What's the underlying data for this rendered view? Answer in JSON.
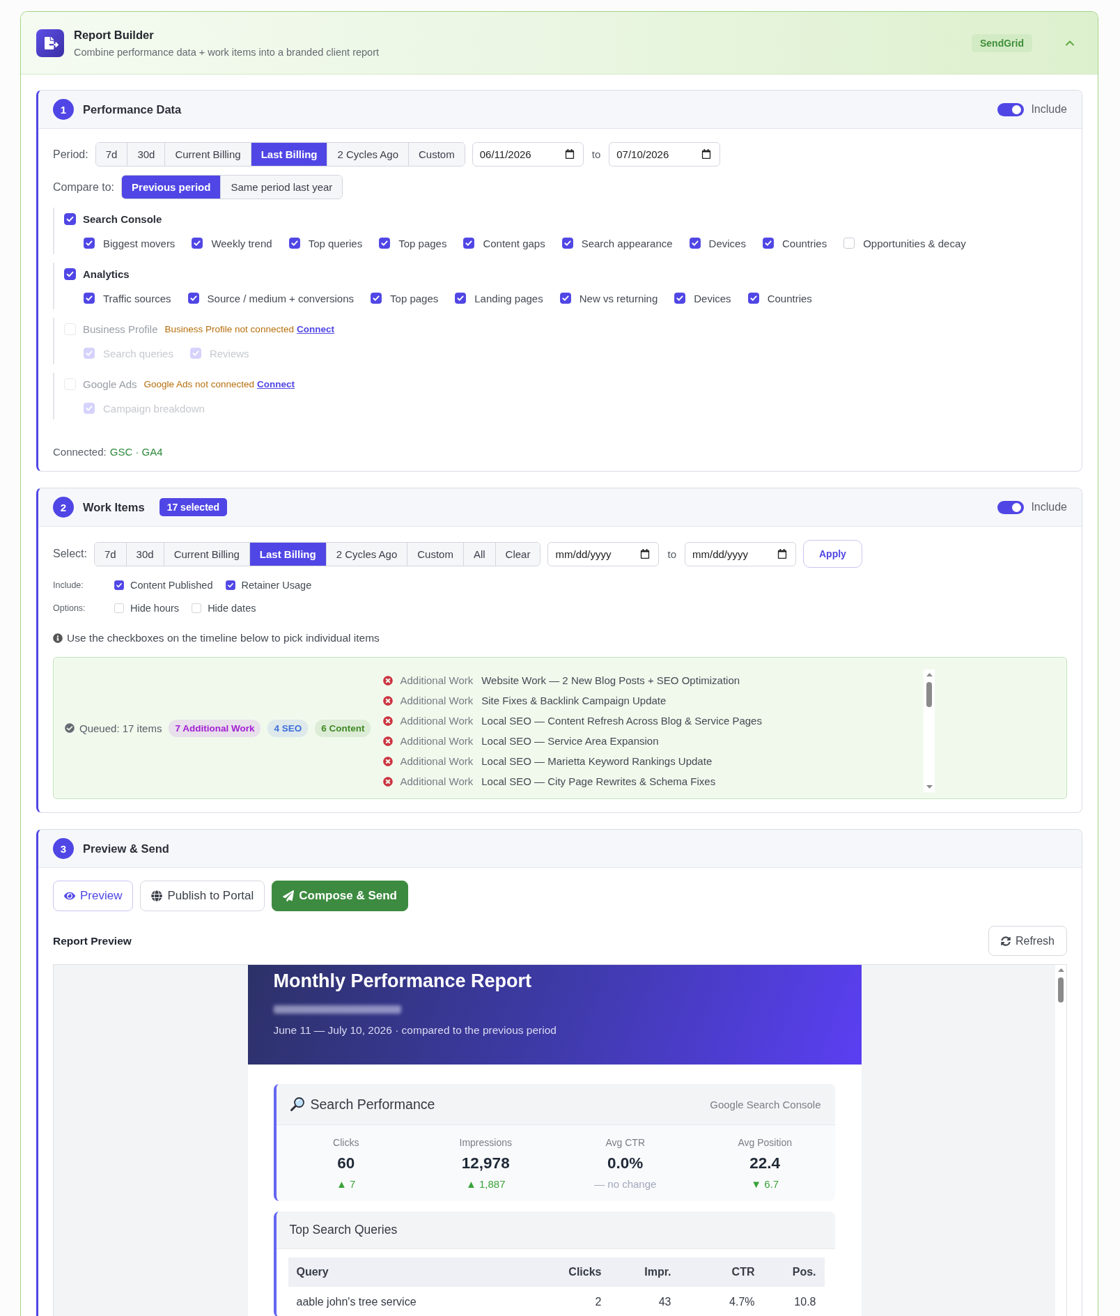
{
  "header": {
    "title": "Report Builder",
    "subtitle": "Combine performance data + work items into a branded client report",
    "badge": "SendGrid",
    "expanded": true
  },
  "performance_data": {
    "step": "1",
    "title": "Performance Data",
    "include": {
      "label": "Include",
      "on": true
    },
    "period": {
      "label": "Period:",
      "options": [
        {
          "label": "7d",
          "selected": false
        },
        {
          "label": "30d",
          "selected": false
        },
        {
          "label": "Current Billing",
          "selected": false
        },
        {
          "label": "Last Billing",
          "selected": true
        },
        {
          "label": "2 Cycles Ago",
          "selected": false
        },
        {
          "label": "Custom",
          "selected": false
        }
      ],
      "from": {
        "value": "06/11/2026"
      },
      "separator": "to",
      "to": {
        "value": "07/10/2026"
      }
    },
    "compare": {
      "label": "Compare to:",
      "options": [
        {
          "label": "Previous period",
          "selected": true
        },
        {
          "label": "Same period last year",
          "selected": false
        }
      ]
    },
    "sources": [
      {
        "label": "Search Console",
        "checked": true,
        "disabled": false,
        "items": [
          {
            "label": "Biggest movers",
            "checked": true
          },
          {
            "label": "Weekly trend",
            "checked": true
          },
          {
            "label": "Top queries",
            "checked": true
          },
          {
            "label": "Top pages",
            "checked": true
          },
          {
            "label": "Content gaps",
            "checked": true
          },
          {
            "label": "Search appearance",
            "checked": true
          },
          {
            "label": "Devices",
            "checked": true
          },
          {
            "label": "Countries",
            "checked": true
          },
          {
            "label": "Opportunities & decay",
            "checked": false
          }
        ]
      },
      {
        "label": "Analytics",
        "checked": true,
        "disabled": false,
        "items": [
          {
            "label": "Traffic sources",
            "checked": true
          },
          {
            "label": "Source / medium + conversions",
            "checked": true
          },
          {
            "label": "Top pages",
            "checked": true
          },
          {
            "label": "Landing pages",
            "checked": true
          },
          {
            "label": "New vs returning",
            "checked": true
          },
          {
            "label": "Devices",
            "checked": true
          },
          {
            "label": "Countries",
            "checked": true
          }
        ]
      },
      {
        "label": "Business Profile",
        "checked": false,
        "disabled": true,
        "status": "Business Profile not connected",
        "link": "Connect",
        "items": [
          {
            "label": "Search queries",
            "checked": true
          },
          {
            "label": "Reviews",
            "checked": true
          }
        ]
      },
      {
        "label": "Google Ads",
        "checked": false,
        "disabled": true,
        "status": "Google Ads not connected",
        "link": "Connect",
        "items": [
          {
            "label": "Campaign breakdown",
            "checked": true
          }
        ]
      }
    ],
    "connected": {
      "label": "Connected:",
      "value": "GSC · GA4"
    }
  },
  "work_items": {
    "step": "2",
    "title": "Work Items",
    "badge": "17 selected",
    "include": {
      "label": "Include",
      "on": true
    },
    "select": {
      "label": "Select:",
      "options": [
        {
          "label": "7d",
          "selected": false
        },
        {
          "label": "30d",
          "selected": false
        },
        {
          "label": "Current Billing",
          "selected": false
        },
        {
          "label": "Last Billing",
          "selected": true
        },
        {
          "label": "2 Cycles Ago",
          "selected": false
        },
        {
          "label": "Custom",
          "selected": false
        },
        {
          "label": "All",
          "selected": false
        },
        {
          "label": "Clear",
          "selected": false
        }
      ],
      "from": {
        "placeholder": "mm/dd/yyyy"
      },
      "separator": "to",
      "to": {
        "placeholder": "mm/dd/yyyy"
      },
      "apply": "Apply"
    },
    "include_types": {
      "label": "Include:",
      "items": [
        {
          "label": "Content Published",
          "checked": true
        },
        {
          "label": "Retainer Usage",
          "checked": true
        }
      ]
    },
    "options": {
      "label": "Options:",
      "items": [
        {
          "label": "Hide hours",
          "checked": false
        },
        {
          "label": "Hide dates",
          "checked": false
        }
      ]
    },
    "hint": "Use the checkboxes on the timeline below to pick individual items",
    "queue": {
      "summary": "Queued: 17 items",
      "tags": [
        {
          "label": "7 Additional Work",
          "color": "#a21fd4"
        },
        {
          "label": "4 SEO",
          "color": "#3d6fd9"
        },
        {
          "label": "6 Content",
          "color": "#3f8a24"
        }
      ],
      "items": [
        {
          "type": "Additional Work",
          "title": "Website Work — 2 New Blog Posts + SEO Optimization"
        },
        {
          "type": "Additional Work",
          "title": "Site Fixes & Backlink Campaign Update"
        },
        {
          "type": "Additional Work",
          "title": "Local SEO — Content Refresh Across Blog & Service Pages"
        },
        {
          "type": "Additional Work",
          "title": "Local SEO — Service Area Expansion"
        },
        {
          "type": "Additional Work",
          "title": "Local SEO — Marietta Keyword Rankings Update"
        },
        {
          "type": "Additional Work",
          "title": "Local SEO — City Page Rewrites & Schema Fixes"
        }
      ]
    }
  },
  "preview_send": {
    "step": "3",
    "title": "Preview & Send",
    "actions": [
      {
        "label": "Preview",
        "kind": "outline"
      },
      {
        "label": "Publish to Portal",
        "kind": "plain"
      },
      {
        "label": "Compose & Send",
        "kind": "primary"
      }
    ],
    "preview_label": "Report Preview",
    "refresh": "Refresh",
    "report": {
      "title": "Monthly Performance Report",
      "period": "June 11 — July 10, 2026 · compared to the previous period",
      "search_performance": {
        "title": "Search Performance",
        "source": "Google Search Console",
        "metrics": [
          {
            "label": "Clicks",
            "value": "60",
            "change": "▲ 7",
            "kind": "positive"
          },
          {
            "label": "Impressions",
            "value": "12,978",
            "change": "▲ 1,887",
            "kind": "positive"
          },
          {
            "label": "Avg CTR",
            "value": "0.0%",
            "change": "— no change",
            "kind": "neutral"
          },
          {
            "label": "Avg Position",
            "value": "22.4",
            "change": "▼ 6.7",
            "kind": "positive"
          }
        ]
      },
      "top_queries": {
        "title": "Top Search Queries",
        "columns": [
          "Query",
          "Clicks",
          "Impr.",
          "CTR",
          "Pos."
        ],
        "rows": [
          [
            "aable john's tree service",
            "2",
            "43",
            "4.7%",
            "10.8"
          ]
        ]
      }
    }
  }
}
